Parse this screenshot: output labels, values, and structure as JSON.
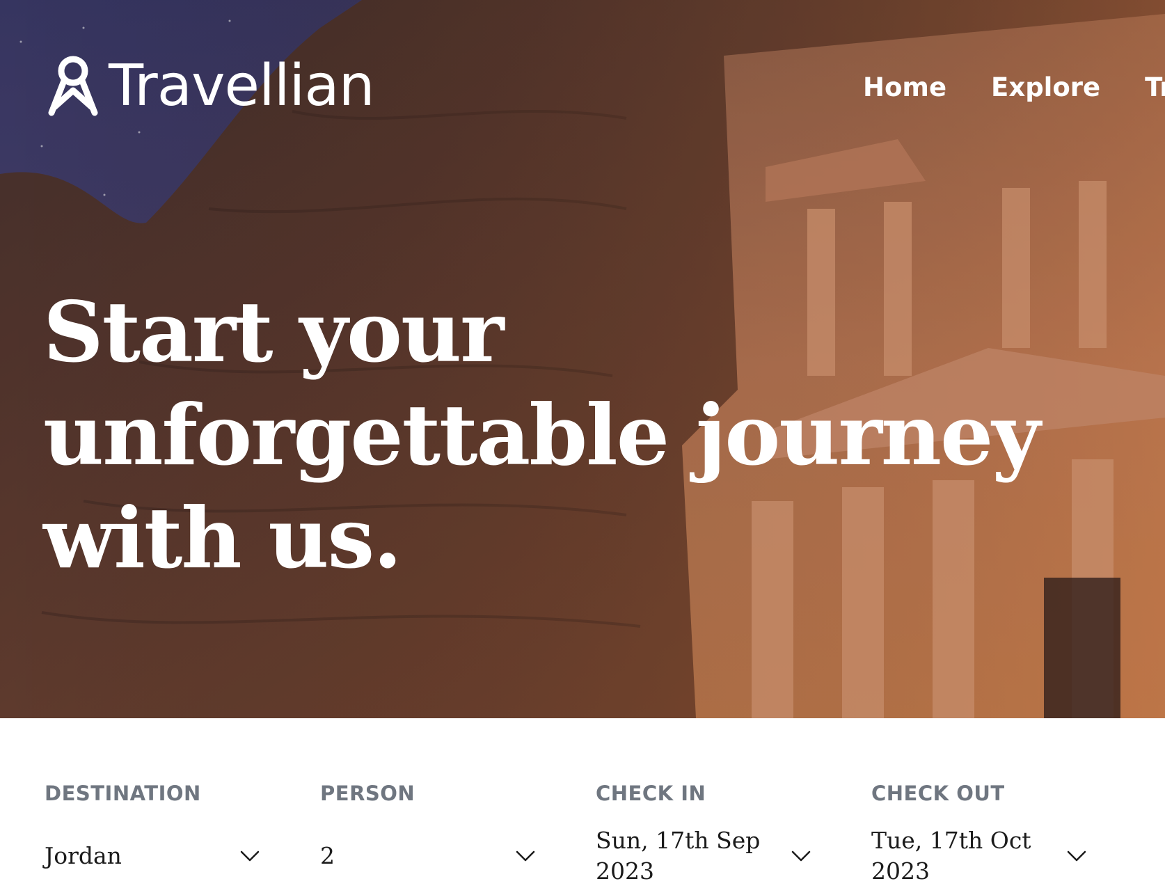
{
  "brand": {
    "name": "Travellian"
  },
  "nav": {
    "items": [
      {
        "label": "Home"
      },
      {
        "label": "Explore"
      },
      {
        "label": "Tra"
      }
    ]
  },
  "hero": {
    "headline": "Start your unforgettable journey with us."
  },
  "booking": {
    "fields": [
      {
        "label": "DESTINATION",
        "value": "Jordan"
      },
      {
        "label": "PERSON",
        "value": "2"
      },
      {
        "label": "CHECK IN",
        "value": "Sun, 17th Sep 2023"
      },
      {
        "label": "CHECK OUT",
        "value": "Tue, 17th Oct 2023"
      }
    ]
  },
  "icons": {
    "logo": "pin-knot-logo-icon",
    "dropdown": "chevron-down-icon"
  },
  "colors": {
    "label": "#6f7680",
    "value": "#1b1b1b",
    "hero_text": "#ffffff"
  }
}
